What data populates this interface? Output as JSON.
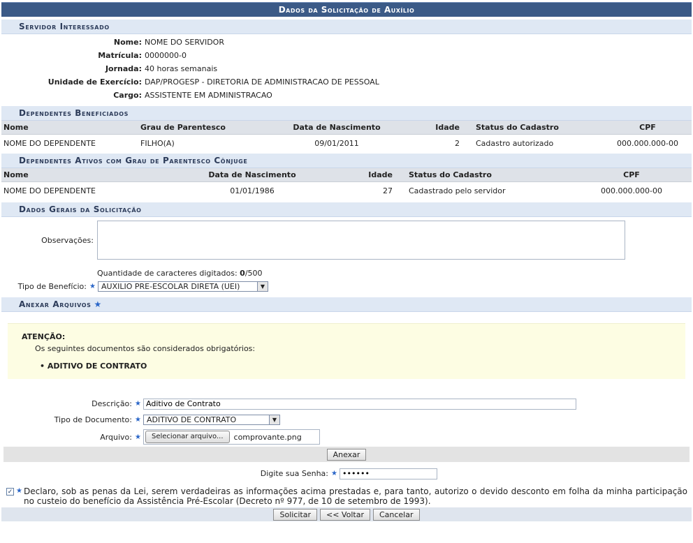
{
  "title": "Dados da Solicitação de Auxílio",
  "servidor": {
    "section": "Servidor Interessado",
    "fields": [
      {
        "label": "Nome:",
        "value": "NOME DO SERVIDOR"
      },
      {
        "label": "Matrícula:",
        "value": "0000000-0"
      },
      {
        "label": "Jornada:",
        "value": "40 horas semanais"
      },
      {
        "label": "Unidade de Exercício:",
        "value": "DAP/PROGESP - DIRETORIA DE ADMINISTRACAO DE PESSOAL"
      },
      {
        "label": "Cargo:",
        "value": "ASSISTENTE EM ADMINISTRACAO"
      }
    ]
  },
  "dependentes": {
    "section": "Dependentes Beneficiados",
    "headers": [
      "Nome",
      "Grau de Parentesco",
      "Data de Nascimento",
      "Idade",
      "Status do Cadastro",
      "CPF"
    ],
    "rows": [
      [
        "NOME DO DEPENDENTE",
        "FILHO(A)",
        "09/01/2011",
        "2",
        "Cadastro autorizado",
        "000.000.000-00"
      ]
    ]
  },
  "conjuge": {
    "section": "Dependentes Ativos com Grau de Parentesco Cônjuge",
    "headers": [
      "Nome",
      "Data de Nascimento",
      "Idade",
      "Status do Cadastro",
      "CPF"
    ],
    "rows": [
      [
        "NOME DO DEPENDENTE",
        "01/01/1986",
        "27",
        "Cadastrado pelo servidor",
        "000.000.000-00"
      ]
    ]
  },
  "dados_gerais": {
    "section": "Dados Gerais da Solicitação",
    "obs_label": "Observações:",
    "obs_value": "",
    "char_count_label": "Quantidade de caracteres digitados:",
    "char_count": "0",
    "char_max": "/500",
    "tipo_label": "Tipo de Benefício:",
    "tipo_value": "AUXILIO PRE-ESCOLAR DIRETA (UEI)"
  },
  "anexar": {
    "section": "Anexar Arquivos",
    "attention_title": "ATENÇÃO:",
    "attention_text": "Os seguintes documentos são considerados obrigatórios:",
    "required_docs": [
      "ADITIVO DE CONTRATO"
    ],
    "descricao_label": "Descrição:",
    "descricao_value": "Aditivo de Contrato",
    "tipo_doc_label": "Tipo de Documento:",
    "tipo_doc_value": "ADITIVO DE CONTRATO",
    "arquivo_label": "Arquivo:",
    "file_button": "Selecionar arquivo...",
    "file_name": "comprovante.png",
    "anexar_button": "Anexar"
  },
  "senha": {
    "label": "Digite sua Senha:",
    "value": "••••••"
  },
  "declaracao": "Declaro, sob as penas da Lei, serem verdadeiras as informações acima prestadas e, para tanto, autorizo o devido desconto em folha da minha participação no custeio do benefício da Assistência Pré-Escolar (Decreto nº 977, de 10 de setembro de 1993).",
  "buttons": {
    "solicitar": "Solicitar",
    "voltar": "<< Voltar",
    "cancelar": "Cancelar"
  },
  "req_mark": "★",
  "check_mark": "✓"
}
